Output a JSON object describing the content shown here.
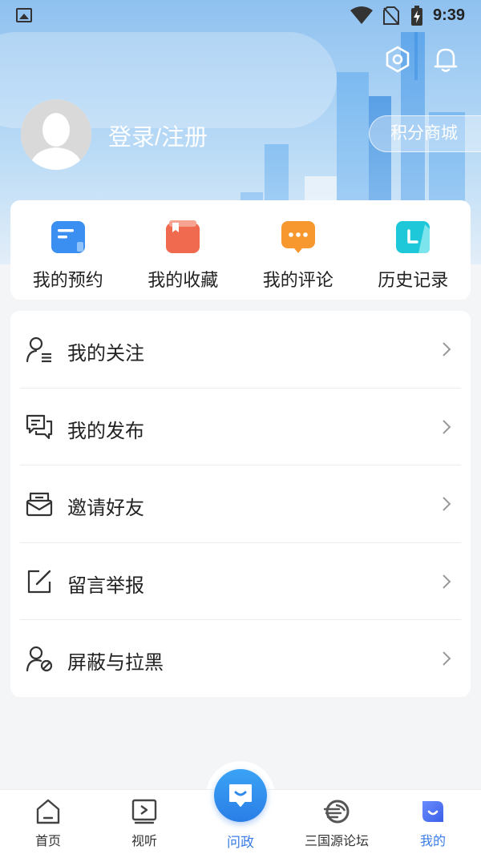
{
  "status_bar": {
    "time": "9:39"
  },
  "header": {
    "login_text": "登录/注册",
    "points_mall": "积分商城",
    "icons": [
      "settings-icon",
      "bell-icon"
    ]
  },
  "quick_actions": [
    {
      "label": "我的预约",
      "icon": "calendar-card-icon",
      "color": "#3b8ff0"
    },
    {
      "label": "我的收藏",
      "icon": "bookmark-icon",
      "color": "#f06a4f"
    },
    {
      "label": "我的评论",
      "icon": "comment-icon",
      "color": "#f7982f"
    },
    {
      "label": "历史记录",
      "icon": "history-icon",
      "color": "#1ec8d8"
    }
  ],
  "menu": [
    {
      "label": "我的关注",
      "icon": "follow-user-icon"
    },
    {
      "label": "我的发布",
      "icon": "chat-bubbles-icon"
    },
    {
      "label": "邀请好友",
      "icon": "invite-envelope-icon"
    },
    {
      "label": "留言举报",
      "icon": "edit-report-icon"
    },
    {
      "label": "屏蔽与拉黑",
      "icon": "block-user-icon"
    }
  ],
  "bottom_nav": [
    {
      "label": "首页",
      "icon": "home-icon"
    },
    {
      "label": "视听",
      "icon": "video-play-icon"
    },
    {
      "label": "问政",
      "icon": "ask-gov-icon"
    },
    {
      "label": "三国源论坛",
      "icon": "forum-logo-icon"
    },
    {
      "label": "我的",
      "icon": "profile-icon",
      "active": true
    }
  ],
  "colors": {
    "accent": "#3a7de6",
    "background": "#f4f5f7"
  }
}
